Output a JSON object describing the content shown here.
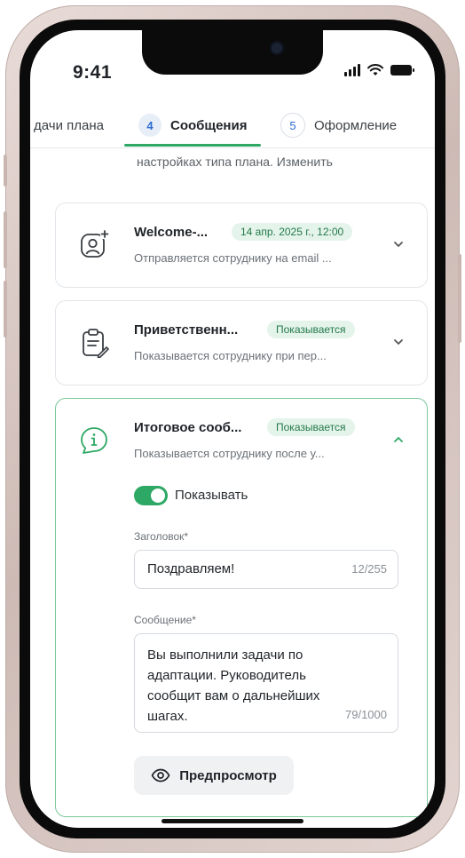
{
  "status": {
    "time": "9:41"
  },
  "tabs": [
    {
      "label": "дачи плана"
    },
    {
      "num": "4",
      "label": "Сообщения"
    },
    {
      "num": "5",
      "label": "Оформление"
    }
  ],
  "description": "настройках типа плана. Изменить",
  "cards": [
    {
      "icon": "user-add-icon",
      "title": "Welcome-...",
      "badge": "14 апр. 2025 г., 12:00",
      "subtitle": "Отправляется сотруднику на email ..."
    },
    {
      "icon": "clipboard-edit-icon",
      "title": "Приветственн...",
      "badge": "Показывается",
      "subtitle": "Показывается сотруднику при пер..."
    },
    {
      "icon": "info-chat-icon",
      "title": "Итоговое сооб...",
      "badge": "Показывается",
      "subtitle": "Показывается сотруднику после у...",
      "toggle_label": "Показывать",
      "header_label": "Заголовок*",
      "header_value": "Поздравляем!",
      "header_counter": "12/255",
      "message_label": "Сообщение*",
      "message_value": "Вы выполнили задачи по адаптации. Руководитель сообщит вам о дальнейших шагах.",
      "message_counter": "79/1000",
      "preview_label": "Предпросмотр"
    }
  ],
  "colors": {
    "accent": "#2ea865",
    "link": "#2d6bd1",
    "badge_bg": "#e4f4ea",
    "badge_text": "#24794a"
  }
}
